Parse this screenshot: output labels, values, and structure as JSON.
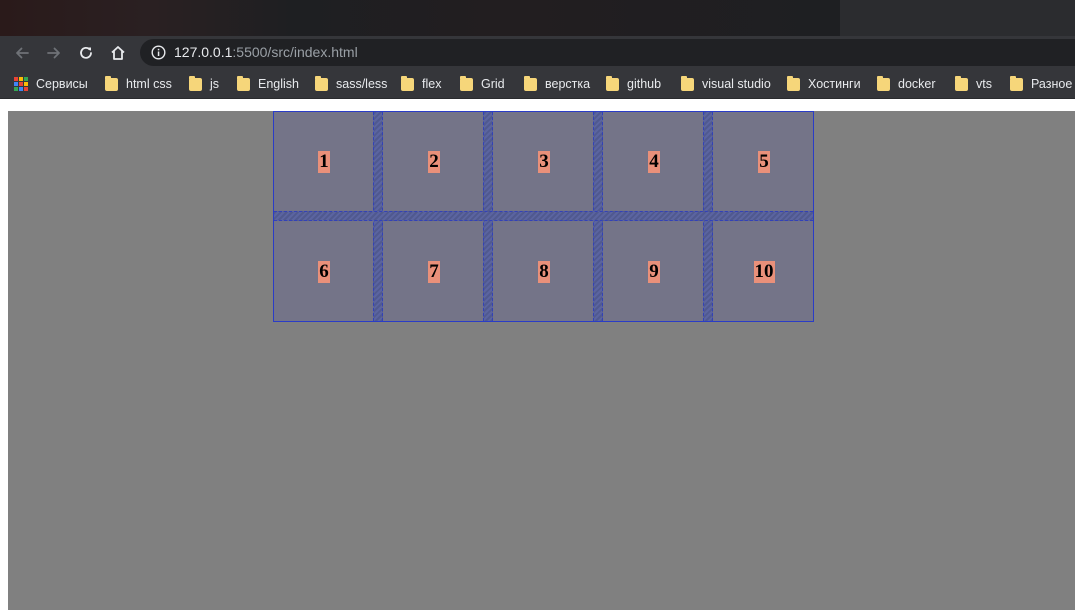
{
  "browser": {
    "url": {
      "host": "127.0.0.1",
      "rest": ":5500/src/index.html"
    },
    "icons": {
      "back": "back-arrow-icon",
      "forward": "forward-arrow-icon",
      "reload": "reload-icon",
      "home": "home-icon",
      "info": "info-icon"
    }
  },
  "bookmarks": {
    "apps_label": "Сервисы",
    "items": [
      {
        "label": "html css"
      },
      {
        "label": "js"
      },
      {
        "label": "English"
      },
      {
        "label": "sass/less"
      },
      {
        "label": "flex"
      },
      {
        "label": "Grid"
      },
      {
        "label": "верстка"
      },
      {
        "label": "github"
      },
      {
        "label": "visual studio"
      },
      {
        "label": "Хостинги"
      },
      {
        "label": "docker"
      },
      {
        "label": "vts"
      },
      {
        "label": "Разное"
      }
    ]
  },
  "page": {
    "colors": {
      "page_bg": "#808080",
      "cell_bg": "#747488",
      "label_bg": "#e9907a",
      "grid_line": "#2a3cc7"
    },
    "grid_items": [
      "1",
      "2",
      "3",
      "4",
      "5",
      "6",
      "7",
      "8",
      "9",
      "10"
    ]
  }
}
